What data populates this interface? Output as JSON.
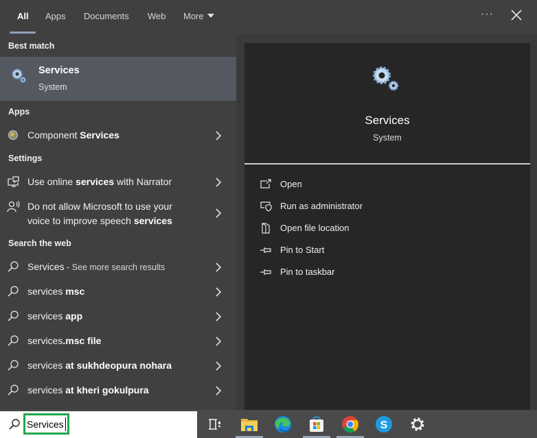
{
  "tabs": [
    {
      "label": "All",
      "active": true
    },
    {
      "label": "Apps"
    },
    {
      "label": "Documents"
    },
    {
      "label": "Web"
    },
    {
      "label": "More"
    }
  ],
  "header": {
    "ellipsis": "···",
    "close_icon": "close-icon"
  },
  "sections": {
    "best_match": "Best match",
    "apps": "Apps",
    "settings": "Settings",
    "search_web": "Search the web"
  },
  "best_match": {
    "title": "Services",
    "subtitle": "System",
    "icon": "services-gears-icon"
  },
  "apps": [
    {
      "prefix": "Component ",
      "bold": "Services",
      "icon": "component-services-icon"
    }
  ],
  "settings": [
    {
      "line1_prefix": "Use online ",
      "line1_bold": "services",
      "line1_suffix": " with Narrator",
      "icon": "narrator-monitor-icon"
    },
    {
      "line1": "Do not allow Microsoft to use your",
      "line2_prefix": "voice to improve speech ",
      "line2_bold": "services",
      "icon": "speech-person-icon"
    }
  ],
  "web": [
    {
      "prefix": "Services",
      "bold": "",
      "hint": " - See more search results"
    },
    {
      "prefix": "services ",
      "bold": "msc"
    },
    {
      "prefix": "services ",
      "bold": "app"
    },
    {
      "prefix": "services",
      "bold": ".msc file"
    },
    {
      "prefix": "services ",
      "bold": "at sukhdeopura nohara"
    },
    {
      "prefix": "services ",
      "bold": "at kheri gokulpura"
    }
  ],
  "preview": {
    "title": "Services",
    "subtitle": "System"
  },
  "actions": [
    {
      "label": "Open",
      "icon": "open-window-icon"
    },
    {
      "label": "Run as administrator",
      "icon": "shield-admin-icon"
    },
    {
      "label": "Open file location",
      "icon": "file-location-icon"
    },
    {
      "label": "Pin to Start",
      "icon": "pin-icon"
    },
    {
      "label": "Pin to taskbar",
      "icon": "pin-icon"
    }
  ],
  "search": {
    "value": "Services",
    "placeholder": ""
  },
  "taskbar": [
    "task-view",
    "file-explorer",
    "edge",
    "microsoft-store",
    "chrome",
    "skype",
    "settings"
  ],
  "colors": {
    "accent_green": "#1fa84a",
    "selected_row": "#545861",
    "preview_bg": "#262626"
  }
}
